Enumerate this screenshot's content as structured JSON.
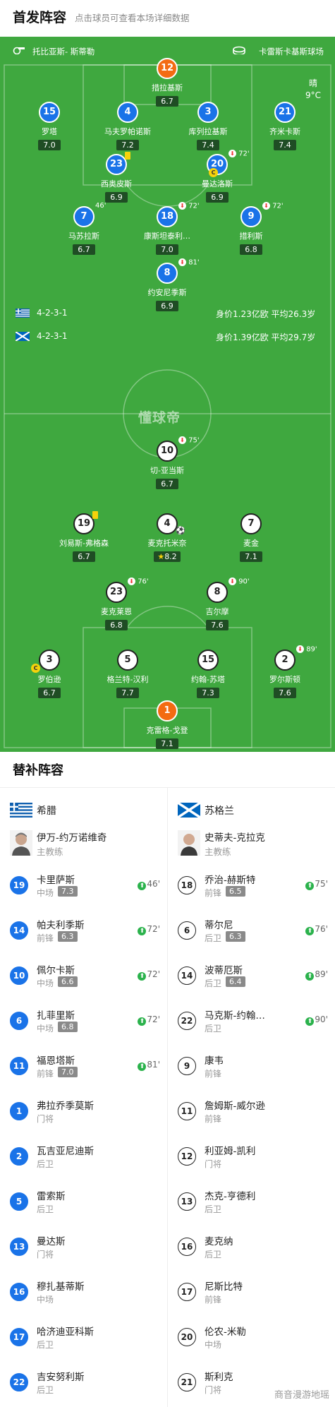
{
  "header": {
    "title": "首发阵容",
    "hint": "点击球员可查看本场详细数据"
  },
  "pitch": {
    "coach_left": "托比亚斯- 斯蒂勒",
    "venue": "卡雷斯卡基斯球场",
    "weather": "晴",
    "temperature": "9°C",
    "watermark": "懂球帝"
  },
  "greece": {
    "formation": "4-2-3-1",
    "value": "身价1.23亿欧  平均26.3岁",
    "players": [
      {
        "num": "12",
        "name": "措拉基斯",
        "rating": "6.7",
        "style": "orange"
      },
      {
        "num": "15",
        "name": "罗塔",
        "rating": "7.0",
        "style": "blue"
      },
      {
        "num": "4",
        "name": "马夫罗帕诺斯",
        "rating": "7.2",
        "style": "blue"
      },
      {
        "num": "3",
        "name": "库列拉基斯",
        "rating": "7.4",
        "style": "blue"
      },
      {
        "num": "21",
        "name": "齐米卡斯",
        "rating": "7.4",
        "style": "blue"
      },
      {
        "num": "23",
        "name": "西奥皮斯",
        "rating": "6.9",
        "style": "blue"
      },
      {
        "num": "20",
        "name": "曼达洛斯",
        "rating": "6.9",
        "style": "blue",
        "sub": "72'"
      },
      {
        "num": "7",
        "name": "马苏拉斯",
        "rating": "6.7",
        "style": "blue",
        "sub": "46'"
      },
      {
        "num": "18",
        "name": "康斯坦泰利…",
        "rating": "7.0",
        "style": "blue",
        "sub": "72'"
      },
      {
        "num": "9",
        "name": "措利斯",
        "rating": "6.8",
        "style": "blue",
        "sub": "72'"
      },
      {
        "num": "8",
        "name": "约安尼季斯",
        "rating": "6.9",
        "style": "blue",
        "sub": "81'"
      }
    ]
  },
  "scotland": {
    "formation": "4-2-3-1",
    "value": "身价1.39亿欧  平均29.7岁",
    "players": [
      {
        "num": "10",
        "name": "切-亚当斯",
        "rating": "6.7",
        "style": "white",
        "sub": "75'"
      },
      {
        "num": "19",
        "name": "刘易斯-弗格森",
        "rating": "6.7",
        "style": "white"
      },
      {
        "num": "4",
        "name": "麦克托米奈",
        "rating": "8.2",
        "style": "white"
      },
      {
        "num": "7",
        "name": "麦金",
        "rating": "7.1",
        "style": "white"
      },
      {
        "num": "23",
        "name": "麦克莱恩",
        "rating": "6.8",
        "style": "white",
        "sub": "76'"
      },
      {
        "num": "8",
        "name": "吉尔摩",
        "rating": "7.6",
        "style": "white",
        "sub": "90'"
      },
      {
        "num": "3",
        "name": "罗伯逊",
        "rating": "6.7",
        "style": "white"
      },
      {
        "num": "5",
        "name": "格兰特-汉利",
        "rating": "7.7",
        "style": "white"
      },
      {
        "num": "15",
        "name": "约翰-苏塔",
        "rating": "7.3",
        "style": "white"
      },
      {
        "num": "2",
        "name": "罗尔斯顿",
        "rating": "7.6",
        "style": "white",
        "sub": "89'"
      },
      {
        "num": "1",
        "name": "克雷格-戈登",
        "rating": "7.1",
        "style": "orange"
      }
    ]
  },
  "subs": {
    "title": "替补阵容",
    "greece": {
      "team": "希腊",
      "coach": "伊万-约万诺维奇",
      "coach_role": "主教练",
      "players": [
        {
          "num": "19",
          "name": "卡里萨斯",
          "pos": "中场",
          "rating": "7.3",
          "min": "46'"
        },
        {
          "num": "14",
          "name": "帕夫利季斯",
          "pos": "前锋",
          "rating": "6.3",
          "min": "72'"
        },
        {
          "num": "10",
          "name": "佩尔卡斯",
          "pos": "中场",
          "rating": "6.6",
          "min": "72'"
        },
        {
          "num": "6",
          "name": "扎菲里斯",
          "pos": "中场",
          "rating": "6.8",
          "min": "72'"
        },
        {
          "num": "11",
          "name": "福恩塔斯",
          "pos": "前锋",
          "rating": "7.0",
          "min": "81'"
        },
        {
          "num": "1",
          "name": "弗拉乔季莫斯",
          "pos": "门将"
        },
        {
          "num": "2",
          "name": "瓦吉亚尼迪斯",
          "pos": "后卫"
        },
        {
          "num": "5",
          "name": "雷索斯",
          "pos": "后卫"
        },
        {
          "num": "13",
          "name": "曼达斯",
          "pos": "门将"
        },
        {
          "num": "16",
          "name": "穆扎基蒂斯",
          "pos": "中场"
        },
        {
          "num": "17",
          "name": "哈济迪亚科斯",
          "pos": "后卫"
        },
        {
          "num": "22",
          "name": "吉安努利斯",
          "pos": "后卫"
        }
      ]
    },
    "scotland": {
      "team": "苏格兰",
      "coach": "史蒂夫-克拉克",
      "coach_role": "主教练",
      "players": [
        {
          "num": "18",
          "name": "乔治-赫斯特",
          "pos": "前锋",
          "rating": "6.5",
          "min": "75'"
        },
        {
          "num": "6",
          "name": "蒂尔尼",
          "pos": "后卫",
          "rating": "6.3",
          "min": "76'"
        },
        {
          "num": "14",
          "name": "波蒂厄斯",
          "pos": "后卫",
          "rating": "6.4",
          "min": "89'"
        },
        {
          "num": "22",
          "name": "马克斯-约翰…",
          "pos": "后卫",
          "min": "90'"
        },
        {
          "num": "9",
          "name": "康韦",
          "pos": "前锋"
        },
        {
          "num": "11",
          "name": "詹姆斯-威尔逊",
          "pos": "前锋"
        },
        {
          "num": "12",
          "name": "利亚姆-凯利",
          "pos": "门将"
        },
        {
          "num": "13",
          "name": "杰克-亨德利",
          "pos": "后卫"
        },
        {
          "num": "16",
          "name": "麦克纳",
          "pos": "后卫"
        },
        {
          "num": "17",
          "name": "尼斯比特",
          "pos": "前锋"
        },
        {
          "num": "20",
          "name": "伦农-米勒",
          "pos": "中场"
        },
        {
          "num": "21",
          "name": "斯利克",
          "pos": "门将"
        }
      ]
    }
  },
  "footer_watermark": "商音漫游地瑶"
}
